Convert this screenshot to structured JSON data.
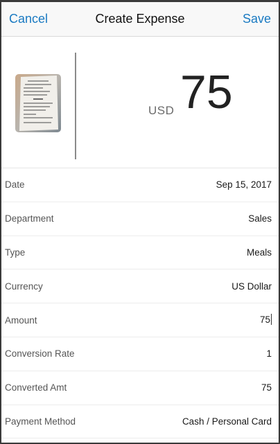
{
  "header": {
    "cancel_label": "Cancel",
    "title": "Create Expense",
    "save_label": "Save"
  },
  "hero": {
    "currency_code": "USD",
    "amount": "75",
    "receipt_icon": "receipt-thumbnail-icon"
  },
  "form": {
    "rows": [
      {
        "label": "Date",
        "value": "Sep 15, 2017"
      },
      {
        "label": "Department",
        "value": "Sales"
      },
      {
        "label": "Type",
        "value": "Meals"
      },
      {
        "label": "Currency",
        "value": "US Dollar"
      },
      {
        "label": "Amount",
        "value": "75"
      },
      {
        "label": "Conversion Rate",
        "value": "1"
      },
      {
        "label": "Converted Amt",
        "value": "75"
      },
      {
        "label": "Payment Method",
        "value": "Cash / Personal Card"
      }
    ]
  },
  "colors": {
    "accent": "#1a7ac2"
  }
}
